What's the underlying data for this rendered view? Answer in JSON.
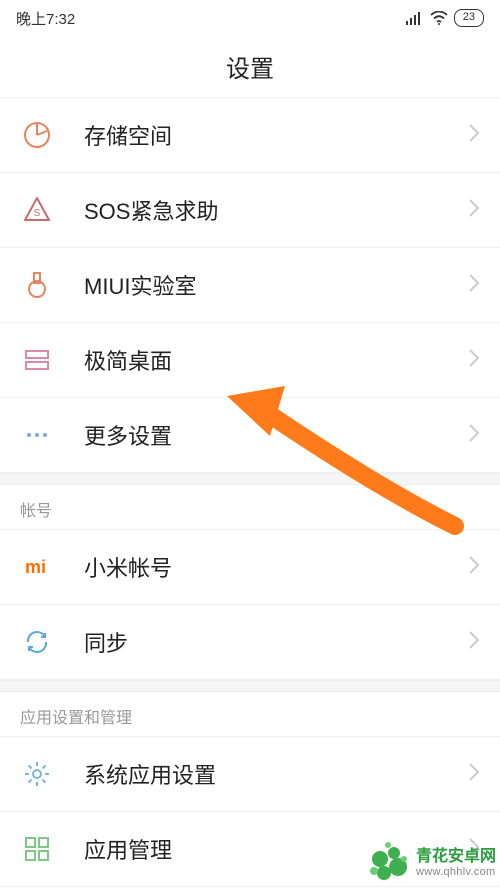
{
  "status_bar": {
    "time": "晚上7:32",
    "battery": "23"
  },
  "header": {
    "title": "设置"
  },
  "settings": {
    "storage_label": "存储空间",
    "sos_label": "SOS紧急求助",
    "miui_lab_label": "MIUI实验室",
    "simple_desktop_label": "极简桌面",
    "more_settings_label": "更多设置"
  },
  "section_account": {
    "header": "帐号",
    "mi_account_label": "小米帐号",
    "sync_label": "同步"
  },
  "section_apps": {
    "header": "应用设置和管理",
    "system_app_label": "系统应用设置",
    "app_manage_label": "应用管理"
  },
  "watermark": {
    "name": "青花安卓网",
    "url": "www.qhhlv.com"
  }
}
